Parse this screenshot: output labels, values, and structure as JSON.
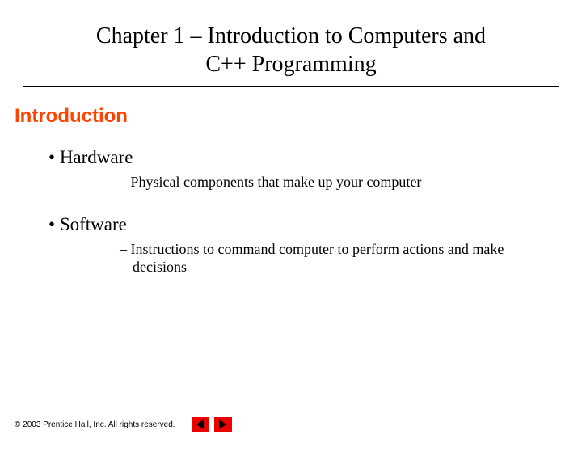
{
  "title": {
    "line1": "Chapter 1 – Introduction to Computers and",
    "line2": "C++ Programming"
  },
  "section_heading": "Introduction",
  "bullets": [
    {
      "label": "Hardware",
      "sub": "Physical components that make up your computer"
    },
    {
      "label": "Software",
      "sub": "Instructions to command computer to perform actions and make decisions"
    }
  ],
  "footer": {
    "copyright": "© 2003 Prentice Hall, Inc. All rights reserved."
  }
}
